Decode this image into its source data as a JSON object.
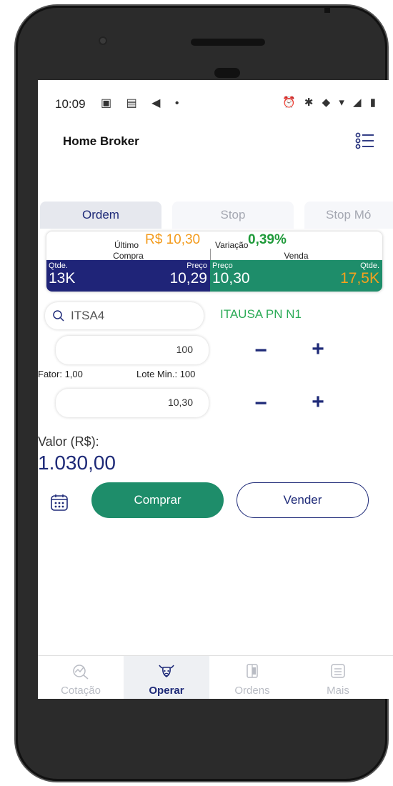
{
  "status_bar": {
    "time": "10:09",
    "left_icons": "▣ ▤ ◀ •",
    "right_icons": "⏰ ✱ ◆ ▾ ◢ ▮"
  },
  "header": {
    "title": "Home Broker",
    "menu_icon": "list-menu-icon"
  },
  "tabs": [
    {
      "label": "Ordem",
      "active": true
    },
    {
      "label": "Stop",
      "active": false
    },
    {
      "label": "Stop Mó",
      "active": false
    }
  ],
  "quote": {
    "ultimo_label": "Último",
    "ultimo_value": "R$ 10,30",
    "variacao_label": "Variação",
    "variacao_value": "0,39%",
    "compra_label": "Compra",
    "venda_label": "Venda",
    "buy": {
      "qtde_label": "Qtde.",
      "qtde_value": "13K",
      "preco_label": "Preço",
      "preco_value": "10,29"
    },
    "sell": {
      "preco_label": "Preço",
      "preco_value": "10,30",
      "qtde_label": "Qtde.",
      "qtde_value": "17,5K"
    }
  },
  "order": {
    "ticker": "ITSA4",
    "asset_name": "ITAUSA PN N1",
    "quantity": "100",
    "fator": "Fator: 1,00",
    "lote_min": "Lote Min.: 100",
    "price": "10,30",
    "minus": "−",
    "plus": "+",
    "valor_label": "Valor (R$):",
    "valor_value": "1.030,00"
  },
  "actions": {
    "comprar": "Comprar",
    "vender": "Vender"
  },
  "bottom_nav": [
    {
      "label": "Cotação",
      "icon": "chart-search-icon",
      "active": false
    },
    {
      "label": "Operar",
      "icon": "bull-icon",
      "active": true
    },
    {
      "label": "Ordens",
      "icon": "orders-icon",
      "active": false
    },
    {
      "label": "Mais",
      "icon": "more-list-icon",
      "active": false
    }
  ],
  "colors": {
    "primary": "#1e2a78",
    "green": "#1e8d6a",
    "orange": "#f39b1d",
    "text_green": "#2cab57"
  }
}
